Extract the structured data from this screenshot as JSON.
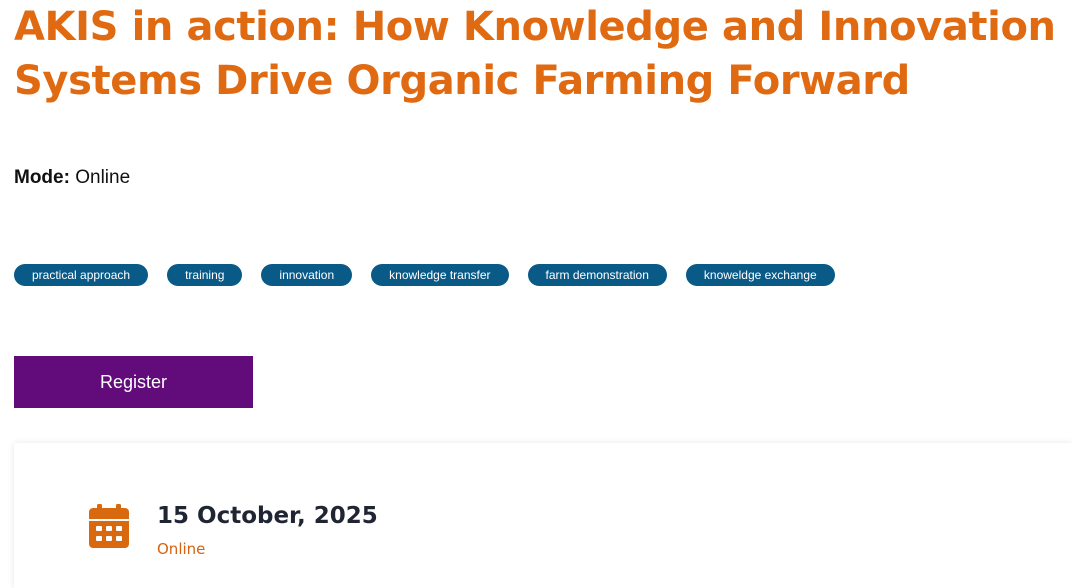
{
  "event": {
    "title": "AKIS in action: How Knowledge and Innovation Systems Drive Organic Farming Forward",
    "mode_label": "Mode:",
    "mode_value": "Online",
    "tags": [
      "practical approach",
      "training",
      "innovation",
      "knowledge transfer",
      "farm demonstration",
      "knoweldge exchange"
    ],
    "register_label": "Register",
    "date": "15 October, 2025",
    "location": "Online"
  },
  "icons": {
    "calendar": "calendar-icon"
  },
  "colors": {
    "title": "#e06a12",
    "tag_background": "#0a5a88",
    "register_button": "#620b7a",
    "date_text": "#1f2533",
    "location_text": "#d4640f",
    "calendar_icon": "#d8690f"
  }
}
